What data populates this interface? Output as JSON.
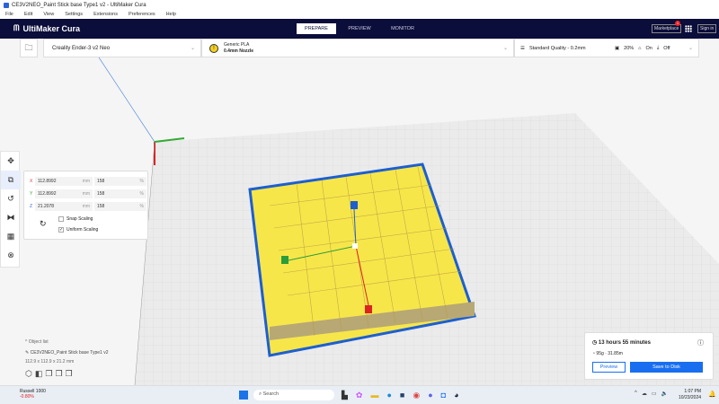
{
  "window": {
    "title": "CE3V2NEO_Paint Stick base Type1 v2 - UltiMaker Cura"
  },
  "menu": [
    "File",
    "Edit",
    "View",
    "Settings",
    "Extensions",
    "Preferences",
    "Help"
  ],
  "header": {
    "logo": "UltiMaker Cura",
    "tabs": [
      "PREPARE",
      "PREVIEW",
      "MONITOR"
    ],
    "marketplace": "Marketplace",
    "marketplace_badge": "1",
    "signin": "Sign in"
  },
  "printer": {
    "name": "Creality Ender-3 v2 Neo"
  },
  "material": {
    "name": "Generic PLA",
    "nozzle": "0.4mm Nozzle"
  },
  "print_settings": {
    "quality": "Standard Quality - 0.2mm",
    "infill": "20%",
    "support": "On",
    "adhesion": "Off"
  },
  "scale": {
    "x": {
      "label": "X",
      "mm": "112.8992",
      "unit": "mm",
      "pct": "158",
      "pct_unit": "%"
    },
    "y": {
      "label": "Y",
      "mm": "112.8992",
      "unit": "mm",
      "pct": "158",
      "pct_unit": "%"
    },
    "z": {
      "label": "Z",
      "mm": "21.2078",
      "unit": "mm",
      "pct": "158",
      "pct_unit": "%"
    },
    "snap": "Snap Scaling",
    "uniform": "Uniform Scaling"
  },
  "objects": {
    "header": "Object list",
    "name": "CE3V2NEO_Paint Stick base Type1 v2",
    "dims": "112.9 x 112.9 x 21.2 mm"
  },
  "result": {
    "time": "13 hours 55 minutes",
    "material": "95g · 31.85m",
    "preview": "Preview",
    "save": "Save to Disk"
  },
  "taskbar": {
    "stock": "Russell 1000",
    "change": "-0.80%",
    "search": "Search",
    "time": "1:07 PM",
    "date": "10/23/2024"
  },
  "colors": {
    "header": "#0b0d3a",
    "accent": "#196ef0",
    "model": "#f7e64a"
  }
}
